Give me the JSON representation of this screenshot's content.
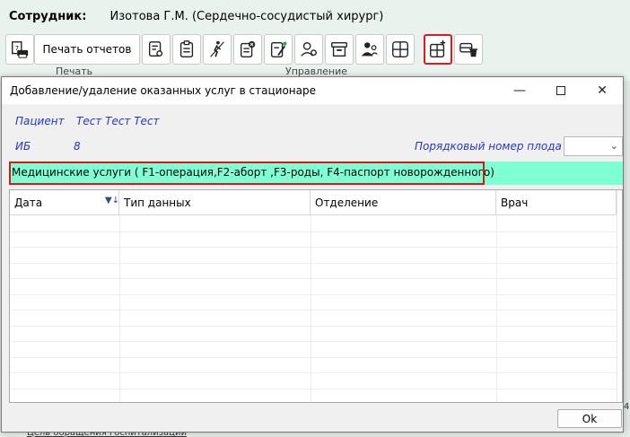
{
  "employee": {
    "label": "Сотрудник:",
    "name": "Изотова Г.М. (Сердечно-сосудистый хирург)"
  },
  "toolbar": {
    "print_reports_label": "Печать отчетов",
    "group_print_label": "Печать",
    "group_manage_label": "Управление"
  },
  "dialog": {
    "title": "Добавление/удаление оказанных услуг в стационаре",
    "patient_label": "Пациент",
    "patient_name": "Тест Тест Тест",
    "ib_label": "ИБ",
    "ib_value": "8",
    "fetus_order_label": "Порядковый номер плода",
    "fetus_order_value": "",
    "services_title": "Медицинские услуги ( F1-операция,F2-аборт ,F3-роды, F4-паспорт новорожденного)",
    "table": {
      "columns": [
        "Дата",
        "Тип данных",
        "Отделение",
        "Врач"
      ],
      "rows": []
    },
    "ok_label": "Ok"
  },
  "background": {
    "bottom_link_text": "Цель обращения госпитализации",
    "right_number": "4"
  },
  "colors": {
    "services_bar": "#7fffd4",
    "highlight": "#d31a1a",
    "field_label": "#2b35c9"
  }
}
